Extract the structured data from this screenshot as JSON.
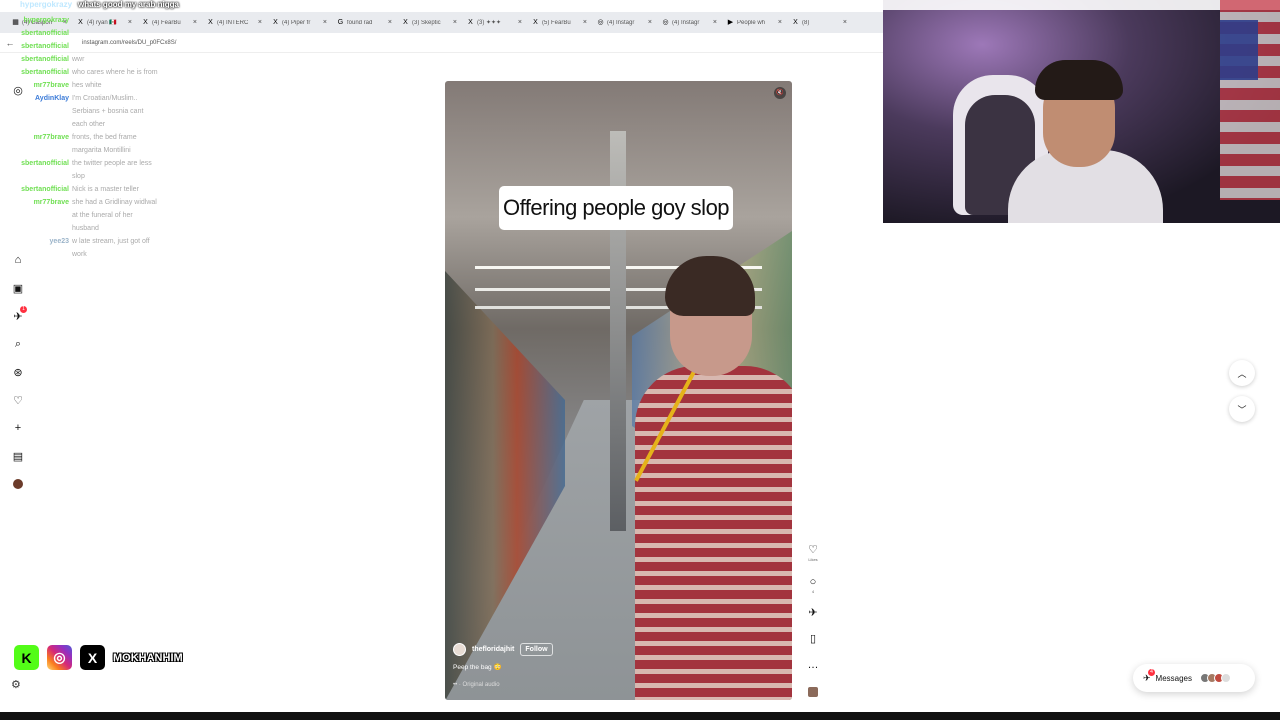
{
  "top_chat": {
    "user": "hypergokrazy",
    "message": "whats good my arab nigga"
  },
  "tabs": [
    {
      "icon": "▦",
      "label": "(4) Gaspon"
    },
    {
      "icon": "X",
      "label": "(4) ryan 🇲🇽"
    },
    {
      "icon": "X",
      "label": "(4) FearBu"
    },
    {
      "icon": "X",
      "label": "(4) INTERC"
    },
    {
      "icon": "X",
      "label": "(4) Piper fr"
    },
    {
      "icon": "G",
      "label": "found rad"
    },
    {
      "icon": "X",
      "label": "(3) Skeptic"
    },
    {
      "icon": "X",
      "label": "(3) ✦✦✦"
    },
    {
      "icon": "X",
      "label": "(5) FearBu"
    },
    {
      "icon": "◎",
      "label": "(4) Instagr"
    },
    {
      "icon": "◎",
      "label": "(4) Instagr"
    },
    {
      "icon": "▶",
      "label": "People wh"
    },
    {
      "icon": "X",
      "label": "(8)"
    }
  ],
  "address": {
    "url": "instagram.com/reels/DU_p0FCx8S/"
  },
  "chat": [
    {
      "user": "hypergokrazy",
      "color": "#6fdf52",
      "message": ""
    },
    {
      "user": "sbertanofficial",
      "color": "#6fdf52",
      "message": ""
    },
    {
      "user": "sbertanofficial",
      "color": "#6fdf52",
      "message": ""
    },
    {
      "user": "sbertanofficial",
      "color": "#6fdf52",
      "message": "wwr"
    },
    {
      "user": "sbertanofficial",
      "color": "#6fdf52",
      "message": "who cares where he is from"
    },
    {
      "user": "mr77brave",
      "color": "#6fdf52",
      "message": "hes white"
    },
    {
      "user": "AydinKlay",
      "color": "#3b7bd8",
      "message": "I'm Croatian/Muslim.."
    },
    {
      "user": "",
      "color": "#3b7bd8",
      "message": "Serbians + bosnia cant"
    },
    {
      "user": "",
      "color": "#3b7bd8",
      "message": "each other"
    },
    {
      "user": "mr77brave",
      "color": "#6fdf52",
      "message": "fronts, the bed frame"
    },
    {
      "user": "",
      "color": "#6fdf52",
      "message": "margarita Montillini"
    },
    {
      "user": "sbertanofficial",
      "color": "#6fdf52",
      "message": "the twitter people are less"
    },
    {
      "user": "",
      "color": "#6fdf52",
      "message": "slop"
    },
    {
      "user": "sbertanofficial",
      "color": "#6fdf52",
      "message": "Nick is a master teller"
    },
    {
      "user": "mr77brave",
      "color": "#6fdf52",
      "message": "she had a Gridlinay widlwal"
    },
    {
      "user": "",
      "color": "#6fdf52",
      "message": "at the funeral of her"
    },
    {
      "user": "",
      "color": "#6fdf52",
      "message": "husband"
    },
    {
      "user": "yee23",
      "color": "#9bb4c9",
      "message": "w late stream, just got off"
    },
    {
      "user": "",
      "color": "#9bb4c9",
      "message": "work"
    }
  ],
  "sidebar": {
    "notifications_count": "1",
    "items": [
      "instagram-logo",
      "home",
      "reels",
      "messages",
      "search",
      "explore",
      "notifications",
      "create",
      "dashboard",
      "profile"
    ]
  },
  "reel": {
    "caption": "Offering people goy slop",
    "owner": "thefloridajhit",
    "follow_label": "Follow",
    "description": "Peep the bag 😳",
    "audio": "•• · Original audio"
  },
  "actions": {
    "likes_label": "Likes",
    "comments_count": "4"
  },
  "messages_label": "Messages",
  "messages_count": "4",
  "socials": {
    "handle": "MOKHANHIM"
  }
}
